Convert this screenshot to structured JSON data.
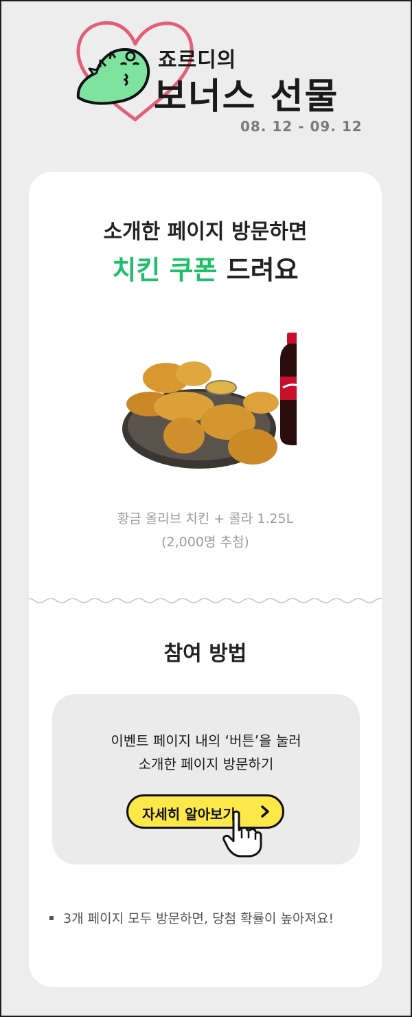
{
  "header": {
    "subtitle": "죠르디의",
    "title": "보너스 선물",
    "dates": "08. 12 - 09. 12"
  },
  "intro": {
    "line1": "소개한 페이지 방문하면",
    "highlight": "치킨 쿠폰",
    "line2_rest": " 드려요"
  },
  "prize": {
    "name": "황금 올리브 치킨 + 콜라 1.25L",
    "count": "(2,000명 추첨)"
  },
  "how": {
    "title": "참여 방법",
    "step_line1": "이벤트 페이지 내의 ‘버튼’을 눌러",
    "step_line2": "소개한 페이지 방문하기",
    "cta_label": "자세히 알아보기"
  },
  "note": {
    "text": "3개 페이지 모두 방문하면, 당첨 확률이 높아져요!"
  },
  "colors": {
    "accent_green": "#1dbf6a",
    "cta_yellow": "#fde84a",
    "heart_pink": "#e0607a",
    "dino_green": "#7fe3a0",
    "background": "#ededed"
  },
  "icons": [
    "heart-outline-icon",
    "jordy-dino-icon",
    "chevron-right-icon",
    "pointing-hand-icon"
  ]
}
